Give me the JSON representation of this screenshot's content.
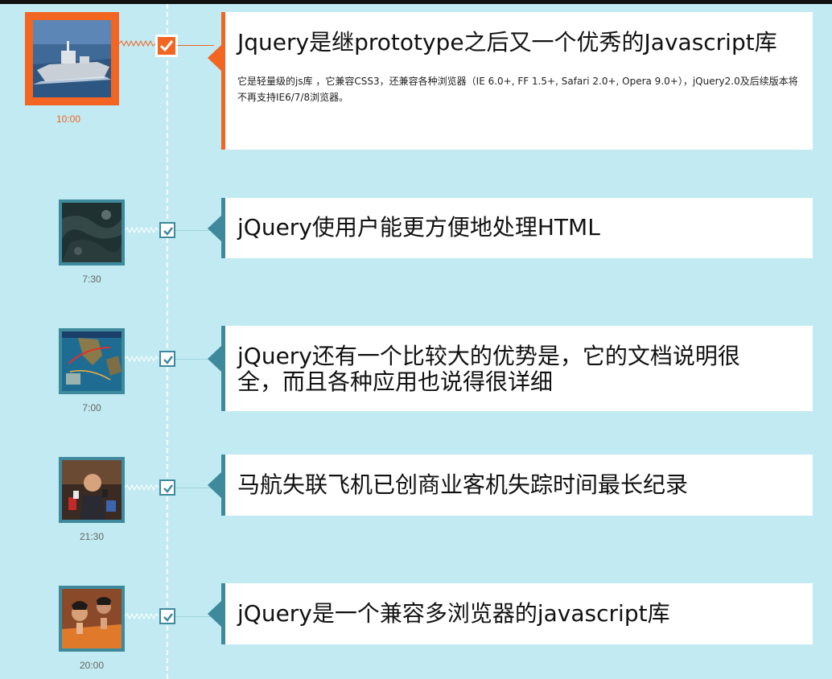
{
  "timeline": {
    "events": [
      {
        "time": "10:00",
        "title": "Jquery是继prototype之后又一个优秀的Javascript库",
        "description": "它是轻量级的js库 ，它兼容CSS3，还兼容各种浏览器（IE 6.0+, FF 1.5+, Safari 2.0+, Opera 9.0+），jQuery2.0及后续版本将不再支持IE6/7/8浏览器。",
        "image_icon": "warship-photo",
        "checked": true
      },
      {
        "time": "7:30",
        "title": "jQuery使用户能更方便地处理HTML",
        "image_icon": "satellite-ocean-photo",
        "checked": true
      },
      {
        "time": "7:00",
        "title": "jQuery还有一个比较大的优势是，它的文档说明很全，而且各种应用也说得很详细",
        "image_icon": "flight-path-map",
        "checked": true
      },
      {
        "time": "21:30",
        "title": "马航失联飞机已创商业客机失踪时间最长纪录",
        "image_icon": "press-conference-photo",
        "checked": true
      },
      {
        "time": "20:00",
        "title": "jQuery是一个兼容多浏览器的javascript库",
        "image_icon": "praying-people-photo",
        "checked": true
      }
    ]
  },
  "colors": {
    "background": "#c2eaf2",
    "active_accent": "#f26522",
    "accent": "#3e8a9c",
    "card": "#ffffff"
  }
}
